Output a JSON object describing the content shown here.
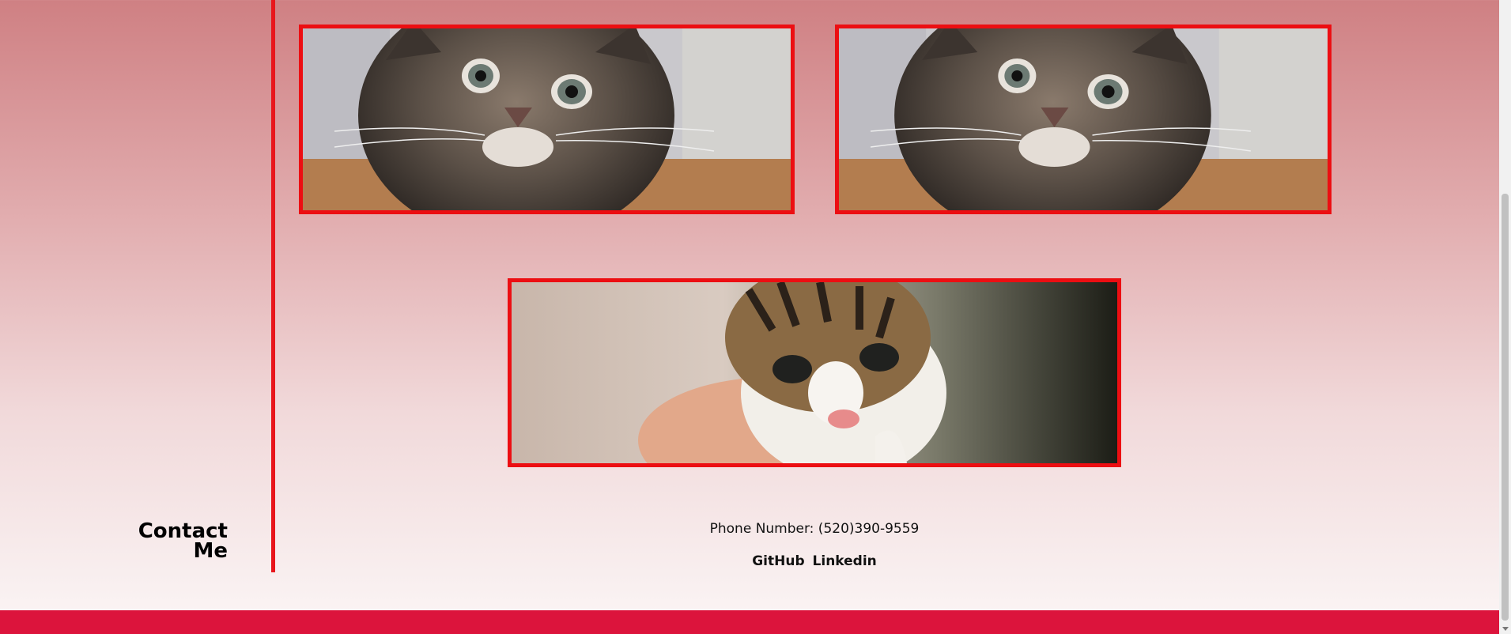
{
  "sidebar": {
    "contact_heading_line1": "Contact",
    "contact_heading_line2": "Me"
  },
  "gallery": {
    "images": [
      {
        "icon": "kitten-photo",
        "subject": "tabby kitten looking up"
      },
      {
        "icon": "kitten-photo",
        "subject": "tabby kitten looking up"
      },
      {
        "icon": "kitten-photo",
        "subject": "tabby and white kitten held in hand"
      }
    ]
  },
  "contact": {
    "phone": "Phone Number: (520)390-9559",
    "links": [
      "GitHub",
      "Linkedin"
    ]
  },
  "colors": {
    "accent": "#ec0e12",
    "footer": "#dc143c",
    "background_top": "#cf8083",
    "background_bottom": "#fbf6f6"
  }
}
